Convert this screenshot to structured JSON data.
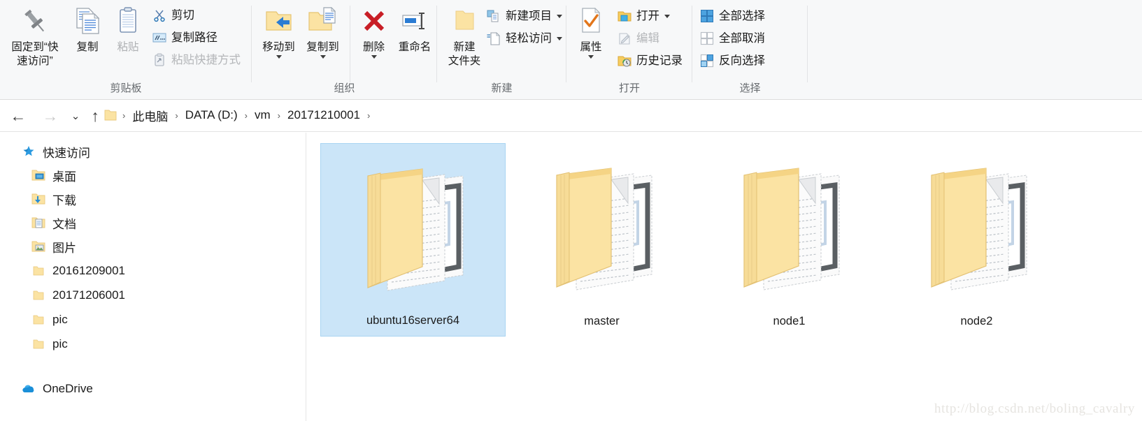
{
  "ribbon": {
    "groups": [
      {
        "name": "clipboard",
        "label": "剪贴板",
        "big_buttons": [
          {
            "label": "固定到“快\n速访问”",
            "label_line1": "固定到“快",
            "label_line2": "速访问”",
            "icon": "pin-icon",
            "enabled": true
          },
          {
            "label": "复制",
            "icon": "copy-icon",
            "enabled": true
          },
          {
            "label": "粘贴",
            "icon": "paste-icon",
            "enabled": false
          }
        ],
        "small_buttons": [
          {
            "label": "剪切",
            "icon": "scissors-icon",
            "enabled": true
          },
          {
            "label": "复制路径",
            "icon": "copy-path-icon",
            "enabled": true
          },
          {
            "label": "粘贴快捷方式",
            "icon": "paste-shortcut-icon",
            "enabled": false
          }
        ]
      },
      {
        "name": "organize",
        "label": "组织",
        "big_buttons": [
          {
            "label": "移动到",
            "icon": "move-to-icon",
            "enabled": true,
            "dropdown": true
          },
          {
            "label": "复制到",
            "icon": "copy-to-icon",
            "enabled": true,
            "dropdown": true
          },
          {
            "label": "删除",
            "icon": "delete-icon",
            "enabled": true,
            "dropdown": true
          },
          {
            "label": "重命名",
            "icon": "rename-icon",
            "enabled": true,
            "dropdown": false
          }
        ]
      },
      {
        "name": "new",
        "label": "新建",
        "big_buttons": [
          {
            "label": "新建\n文件夹",
            "label_line1": "新建",
            "label_line2": "文件夹",
            "icon": "new-folder-icon",
            "enabled": true
          }
        ],
        "small_buttons": [
          {
            "label": "新建项目",
            "icon": "new-item-icon",
            "enabled": true,
            "dropdown": true
          },
          {
            "label": "轻松访问",
            "icon": "easy-access-icon",
            "enabled": true,
            "dropdown": true
          }
        ]
      },
      {
        "name": "open",
        "label": "打开",
        "big_buttons": [
          {
            "label": "属性",
            "icon": "properties-icon",
            "enabled": true,
            "dropdown": true
          }
        ],
        "small_buttons": [
          {
            "label": "打开",
            "icon": "open-icon",
            "enabled": true,
            "dropdown": true
          },
          {
            "label": "编辑",
            "icon": "edit-icon",
            "enabled": false
          },
          {
            "label": "历史记录",
            "icon": "history-icon",
            "enabled": true
          }
        ]
      },
      {
        "name": "select",
        "label": "选择",
        "small_buttons": [
          {
            "label": "全部选择",
            "icon": "select-all-icon",
            "enabled": true
          },
          {
            "label": "全部取消",
            "icon": "select-none-icon",
            "enabled": true
          },
          {
            "label": "反向选择",
            "icon": "invert-selection-icon",
            "enabled": true
          }
        ]
      }
    ]
  },
  "address_bar": {
    "back_label": "←",
    "forward_label": "→",
    "recent_label": "⌄",
    "up_label": "↑",
    "folder_icon": "folder-icon",
    "breadcrumbs": [
      {
        "label": "此电脑"
      },
      {
        "label": "DATA (D:)"
      },
      {
        "label": "vm"
      },
      {
        "label": "20171210001"
      }
    ],
    "separator": "›"
  },
  "sidebar": {
    "items": [
      {
        "label": "快速访问",
        "icon": "star-pin-icon",
        "indent": 0,
        "pinned": false
      },
      {
        "label": "桌面",
        "icon": "desktop-folder-icon",
        "indent": 1,
        "pinned": true
      },
      {
        "label": "下载",
        "icon": "downloads-folder-icon",
        "indent": 1,
        "pinned": true
      },
      {
        "label": "文档",
        "icon": "documents-folder-icon",
        "indent": 1,
        "pinned": true
      },
      {
        "label": "图片",
        "icon": "pictures-folder-icon",
        "indent": 1,
        "pinned": true
      },
      {
        "label": "20161209001",
        "icon": "folder-icon",
        "indent": 1,
        "pinned": false
      },
      {
        "label": "20171206001",
        "icon": "folder-icon",
        "indent": 1,
        "pinned": false
      },
      {
        "label": "pic",
        "icon": "folder-icon",
        "indent": 1,
        "pinned": false
      },
      {
        "label": "pic",
        "icon": "folder-icon",
        "indent": 1,
        "pinned": false
      },
      {
        "label": "OneDrive",
        "icon": "onedrive-cloud-icon",
        "indent": 0,
        "pinned": false
      }
    ]
  },
  "content": {
    "items": [
      {
        "label": "ubuntu16server64",
        "icon": "folder-open-docs-icon",
        "selected": true
      },
      {
        "label": "master",
        "icon": "folder-open-docs-icon",
        "selected": false
      },
      {
        "label": "node1",
        "icon": "folder-open-docs-icon",
        "selected": false
      },
      {
        "label": "node2",
        "icon": "folder-open-docs-icon",
        "selected": false
      }
    ],
    "watermark": "http://blog.csdn.net/boling_cavalry"
  },
  "colors": {
    "selection_fill": "#cbe5f8",
    "selection_border": "#a9d4f2",
    "ribbon_bg": "#f7f8f9",
    "accent_blue": "#2a7fd4",
    "folder_yellow": "#fbe2a0"
  }
}
